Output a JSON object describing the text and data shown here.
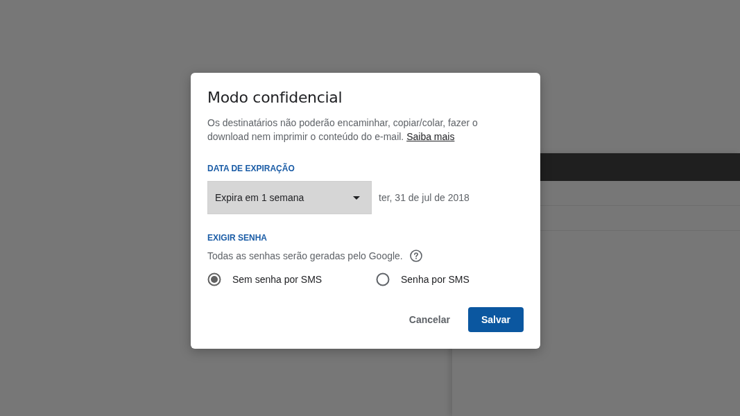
{
  "dialog": {
    "title": "Modo confidencial",
    "description": "Os destinatários não poderão encaminhar, copiar/colar, fazer o download nem imprimir o conteúdo do e-mail.",
    "learn_more_link": "Saiba mais",
    "expiration": {
      "label": "DATA DE EXPIRAÇÃO",
      "dropdown_value": "Expira em 1 semana",
      "date": "ter, 31 de jul de 2018"
    },
    "password": {
      "label": "EXIGIR SENHA",
      "note": "Todas as senhas serão geradas pelo Google.",
      "options": [
        {
          "label": "Sem senha por SMS",
          "selected": true
        },
        {
          "label": "Senha por SMS",
          "selected": false
        }
      ]
    },
    "buttons": [
      {
        "label": "Cancelar",
        "kind": "text"
      },
      {
        "label": "Salvar",
        "kind": "primary"
      }
    ]
  }
}
